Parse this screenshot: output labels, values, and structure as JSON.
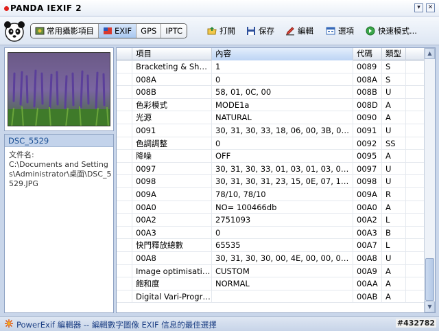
{
  "window": {
    "title": "PANDA IEXIF 2"
  },
  "toolbar": {
    "tabs": [
      {
        "label": "常用攝影項目",
        "icon": "camera-photo-icon"
      },
      {
        "label": "EXIF",
        "icon": "exif-flag-icon",
        "active": true
      },
      {
        "label": "GPS"
      },
      {
        "label": "IPTC"
      }
    ],
    "buttons": [
      {
        "label": "打開",
        "icon": "open-folder-icon"
      },
      {
        "label": "保存",
        "icon": "floppy-disk-icon"
      },
      {
        "label": "編輯",
        "icon": "edit-icon"
      },
      {
        "label": "選項",
        "icon": "options-icon"
      },
      {
        "label": "快速模式...",
        "icon": "quick-mode-icon"
      }
    ]
  },
  "preview": {
    "filename": "DSC_5529",
    "label": "文件名:",
    "path": "C:\\Documents and Settings\\Administrator\\桌面\\DSC_5529.JPG"
  },
  "grid": {
    "headers": [
      "",
      "項目",
      "內容",
      "代碼",
      "類型",
      ""
    ],
    "rows": [
      [
        "Bracketing & Shoo...",
        "1",
        "0089",
        "S"
      ],
      [
        "008A",
        "0",
        "008A",
        "S"
      ],
      [
        "008B",
        "58, 01, 0C, 00",
        "008B",
        "U"
      ],
      [
        "色彩模式",
        "MODE1a",
        "008D",
        "A"
      ],
      [
        "光源",
        "NATURAL",
        "0090",
        "A"
      ],
      [
        "0091",
        "30, 31, 30, 33, 18, 06, 00, 3B, 00, ...",
        "0091",
        "U"
      ],
      [
        "色調調整",
        "0",
        "0092",
        "SS"
      ],
      [
        "降噪",
        "OFF",
        "0095",
        "A"
      ],
      [
        "0097",
        "30, 31, 30, 33, 01, 03, 01, 03, 01, ...",
        "0097",
        "U"
      ],
      [
        "0098",
        "30, 31, 30, 31, 23, 15, 0E, 07, 11, ...",
        "0098",
        "U"
      ],
      [
        "009A",
        "78/10, 78/10",
        "009A",
        "R"
      ],
      [
        "00A0",
        "NO= 100466db",
        "00A0",
        "A"
      ],
      [
        "00A2",
        "2751093",
        "00A2",
        "L"
      ],
      [
        "00A3",
        "0",
        "00A3",
        "B"
      ],
      [
        "快門釋放總數",
        "65535",
        "00A7",
        "L"
      ],
      [
        "00A8",
        "30, 31, 30, 30, 00, 4E, 00, 00, 00, ...",
        "00A8",
        "U"
      ],
      [
        "Image optimisation",
        "CUSTOM",
        "00A9",
        "A"
      ],
      [
        "飽和度",
        "NORMAL",
        "00AA",
        "A"
      ],
      [
        "Digital Vari-Program",
        "",
        "00AB",
        "A"
      ]
    ]
  },
  "status": {
    "text": "PowerExif 編輯器 -- 編輯數字圖像 EXIF 信息的最佳選擇",
    "icon": "star-burst-icon",
    "id_badge": "#432782"
  },
  "colors": {
    "accent": "#1c3f84",
    "panel": "#c9d6ea",
    "selected_tab": "#a9c8f0"
  }
}
